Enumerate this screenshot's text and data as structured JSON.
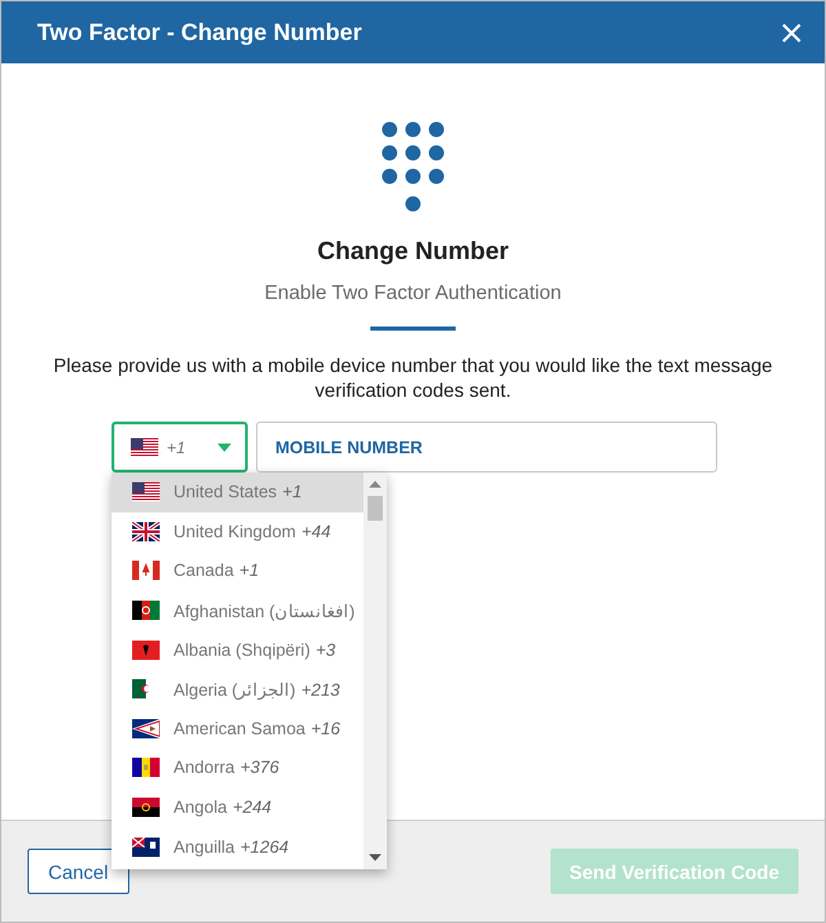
{
  "window": {
    "title": "Two Factor - Change Number"
  },
  "heading": "Change Number",
  "subtitle": "Enable Two Factor Authentication",
  "message": "Please provide us with a mobile device number that you would like the text message verification codes sent.",
  "country_select": {
    "code": "+1",
    "kind": "us",
    "open": true
  },
  "mobile_field": {
    "placeholder": "MOBILE NUMBER"
  },
  "countries": [
    {
      "name": "United States",
      "code": "+1",
      "kind": "us",
      "selected": true
    },
    {
      "name": "United Kingdom",
      "code": "+44",
      "kind": "gb",
      "selected": false
    },
    {
      "name": "Canada",
      "code": "+1",
      "kind": "ca",
      "selected": false
    },
    {
      "name": "Afghanistan (افغانستان)",
      "kind": "af",
      "selected": false
    },
    {
      "name": "Albania (Shqipëri)",
      "code": "+3",
      "kind": "al",
      "selected": false
    },
    {
      "name": "Algeria (الجزائر)",
      "code": "+213",
      "kind": "dz",
      "selected": false
    },
    {
      "name": "American Samoa",
      "code": "+16",
      "kind": "as",
      "selected": false
    },
    {
      "name": "Andorra",
      "code": "+376",
      "kind": "ad",
      "selected": false
    },
    {
      "name": "Angola",
      "code": "+244",
      "kind": "ao",
      "selected": false
    },
    {
      "name": "Anguilla",
      "code": "+1264",
      "kind": "ai",
      "selected": false
    }
  ],
  "buttons": [
    {
      "label": "Cancel",
      "kind": "secondary",
      "disabled": false
    },
    {
      "label": "Send Verification Code",
      "kind": "primary",
      "disabled": true
    }
  ]
}
